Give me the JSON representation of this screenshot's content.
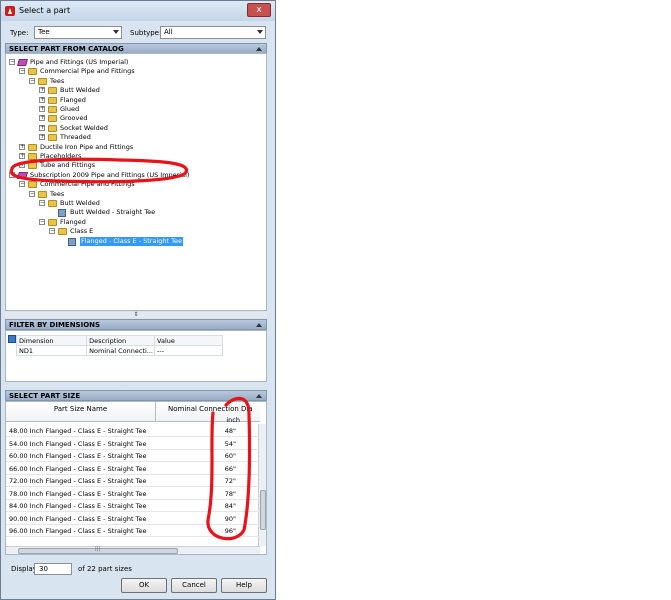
{
  "window": {
    "title": "Select a part",
    "close_glyph": "x"
  },
  "filters": {
    "type_label": "Type:",
    "type_value": "Tee",
    "subtype_label": "Subtype:",
    "subtype_value": "All"
  },
  "catalog": {
    "header": "SELECT PART FROM CATALOG",
    "nodes": [
      {
        "text": "Pipe and Fittings (US Imperial)",
        "icon": "catalog-icon",
        "expander": "−"
      },
      {
        "text": "Commercial Pipe and Fittings",
        "icon": "folder-icon",
        "expander": "−"
      },
      {
        "text": "Tees",
        "icon": "folder-icon",
        "expander": "−"
      },
      {
        "text": "Butt Welded",
        "icon": "folder-icon",
        "expander": "+"
      },
      {
        "text": "Flanged",
        "icon": "folder-icon",
        "expander": "+"
      },
      {
        "text": "Glued",
        "icon": "folder-icon",
        "expander": "+"
      },
      {
        "text": "Grooved",
        "icon": "folder-icon",
        "expander": "+"
      },
      {
        "text": "Socket Welded",
        "icon": "folder-icon",
        "expander": "+"
      },
      {
        "text": "Threaded",
        "icon": "folder-icon",
        "expander": "+"
      },
      {
        "text": "Ductile Iron Pipe and Fittings",
        "icon": "folder-icon",
        "expander": "+"
      },
      {
        "text": "Placeholders",
        "icon": "folder-icon",
        "expander": "+"
      },
      {
        "text": "Tube and Fittings",
        "icon": "folder-icon",
        "expander": "+"
      },
      {
        "text": "Subscription 2009 Pipe and Fittings (US Imperial)",
        "icon": "catalog-icon",
        "expander": "−"
      },
      {
        "text": "Commercial Pipe and Fittings",
        "icon": "folder-icon",
        "expander": "−"
      },
      {
        "text": "Tees",
        "icon": "folder-icon",
        "expander": "−"
      },
      {
        "text": "Butt Welded",
        "icon": "folder-icon",
        "expander": "−"
      },
      {
        "text": "Butt Welded - Straight Tee",
        "icon": "part-icon",
        "expander": ""
      },
      {
        "text": "Flanged",
        "icon": "folder-icon",
        "expander": "−"
      },
      {
        "text": "Class E",
        "icon": "folder-icon",
        "expander": "−"
      },
      {
        "text": "Flanged - Class E - Straight Tee",
        "icon": "part-icon",
        "expander": ""
      }
    ],
    "selected_index": 19,
    "splitter_glyph": "⇕"
  },
  "filter_by_dimensions": {
    "header": "FILTER BY DIMENSIONS",
    "columns": [
      "Dimension",
      "Description",
      "Value"
    ],
    "rows": [
      {
        "dimension": "ND1",
        "description": "Nominal Connecti...",
        "value": "---"
      }
    ]
  },
  "part_size": {
    "header": "SELECT PART SIZE",
    "col_name": "Part Size Name",
    "col_value": "Nominal Connection Dia",
    "unit": "inch",
    "rows": [
      {
        "name": "48.00 Inch Flanged - Class E - Straight Tee",
        "value": "48\""
      },
      {
        "name": "54.00 Inch Flanged - Class E - Straight Tee",
        "value": "54\""
      },
      {
        "name": "60.00 Inch Flanged - Class E - Straight Tee",
        "value": "60\""
      },
      {
        "name": "66.00 Inch Flanged - Class E - Straight Tee",
        "value": "66\""
      },
      {
        "name": "72.00 Inch Flanged - Class E - Straight Tee",
        "value": "72\""
      },
      {
        "name": "78.00 Inch Flanged - Class E - Straight Tee",
        "value": "78\""
      },
      {
        "name": "84.00 Inch Flanged - Class E - Straight Tee",
        "value": "84\""
      },
      {
        "name": "90.00 Inch Flanged - Class E - Straight Tee",
        "value": "90\""
      },
      {
        "name": "96.00 Inch Flanged - Class E - Straight Tee",
        "value": "96\""
      }
    ]
  },
  "display": {
    "label": "Display",
    "value": "30",
    "suffix": "of 22 part sizes"
  },
  "buttons": {
    "ok": "OK",
    "cancel": "Cancel",
    "help": "Help"
  },
  "annotation_color": "#e8131a"
}
